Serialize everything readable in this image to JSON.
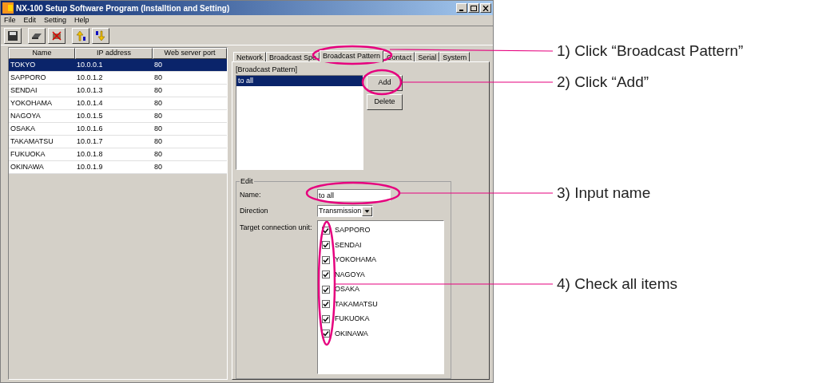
{
  "window": {
    "title": "NX-100 Setup Software Program (Installtion and Setting)"
  },
  "menu": [
    "File",
    "Edit",
    "Setting",
    "Help"
  ],
  "units_table": {
    "columns": [
      "Name",
      "IP address",
      "Web server port"
    ],
    "rows": [
      {
        "cells": [
          "TOKYO",
          "10.0.0.1",
          "80"
        ],
        "selected": true
      },
      {
        "cells": [
          "SAPPORO",
          "10.0.1.2",
          "80"
        ],
        "selected": false
      },
      {
        "cells": [
          "SENDAI",
          "10.0.1.3",
          "80"
        ],
        "selected": false
      },
      {
        "cells": [
          "YOKOHAMA",
          "10.0.1.4",
          "80"
        ],
        "selected": false
      },
      {
        "cells": [
          "NAGOYA",
          "10.0.1.5",
          "80"
        ],
        "selected": false
      },
      {
        "cells": [
          "OSAKA",
          "10.0.1.6",
          "80"
        ],
        "selected": false
      },
      {
        "cells": [
          "TAKAMATSU",
          "10.0.1.7",
          "80"
        ],
        "selected": false
      },
      {
        "cells": [
          "FUKUOKA",
          "10.0.1.8",
          "80"
        ],
        "selected": false
      },
      {
        "cells": [
          "OKINAWA",
          "10.0.1.9",
          "80"
        ],
        "selected": false
      }
    ]
  },
  "tabs": [
    {
      "label": "Network",
      "selected": false
    },
    {
      "label": "Broadcast Spe",
      "selected": false
    },
    {
      "label": "Broadcast Pattern",
      "selected": true
    },
    {
      "label": "Contact",
      "selected": false
    },
    {
      "label": "Serial",
      "selected": false
    },
    {
      "label": "System",
      "selected": false
    }
  ],
  "pattern_panel": {
    "heading": "[Broadcast Pattern]",
    "patterns": [
      {
        "label": "to all",
        "selected": true
      }
    ],
    "buttons": [
      "Add",
      "Delete"
    ]
  },
  "edit": {
    "legend": "Edit",
    "name_label": "Name:",
    "name_value": "to all",
    "direction_label": "Direction",
    "direction_value": "Transmission",
    "target_label": "Target connection unit:",
    "targets": [
      {
        "label": "SAPPORO",
        "checked": true
      },
      {
        "label": "SENDAI",
        "checked": true
      },
      {
        "label": "YOKOHAMA",
        "checked": true
      },
      {
        "label": "NAGOYA",
        "checked": true
      },
      {
        "label": "OSAKA",
        "checked": true
      },
      {
        "label": "TAKAMATSU",
        "checked": true
      },
      {
        "label": "FUKUOKA",
        "checked": true
      },
      {
        "label": "OKINAWA",
        "checked": true
      }
    ]
  },
  "callouts": [
    "1) Click “Broadcast Pattern”",
    "2) Click “Add”",
    "3) Input name",
    "4) Check all items"
  ]
}
